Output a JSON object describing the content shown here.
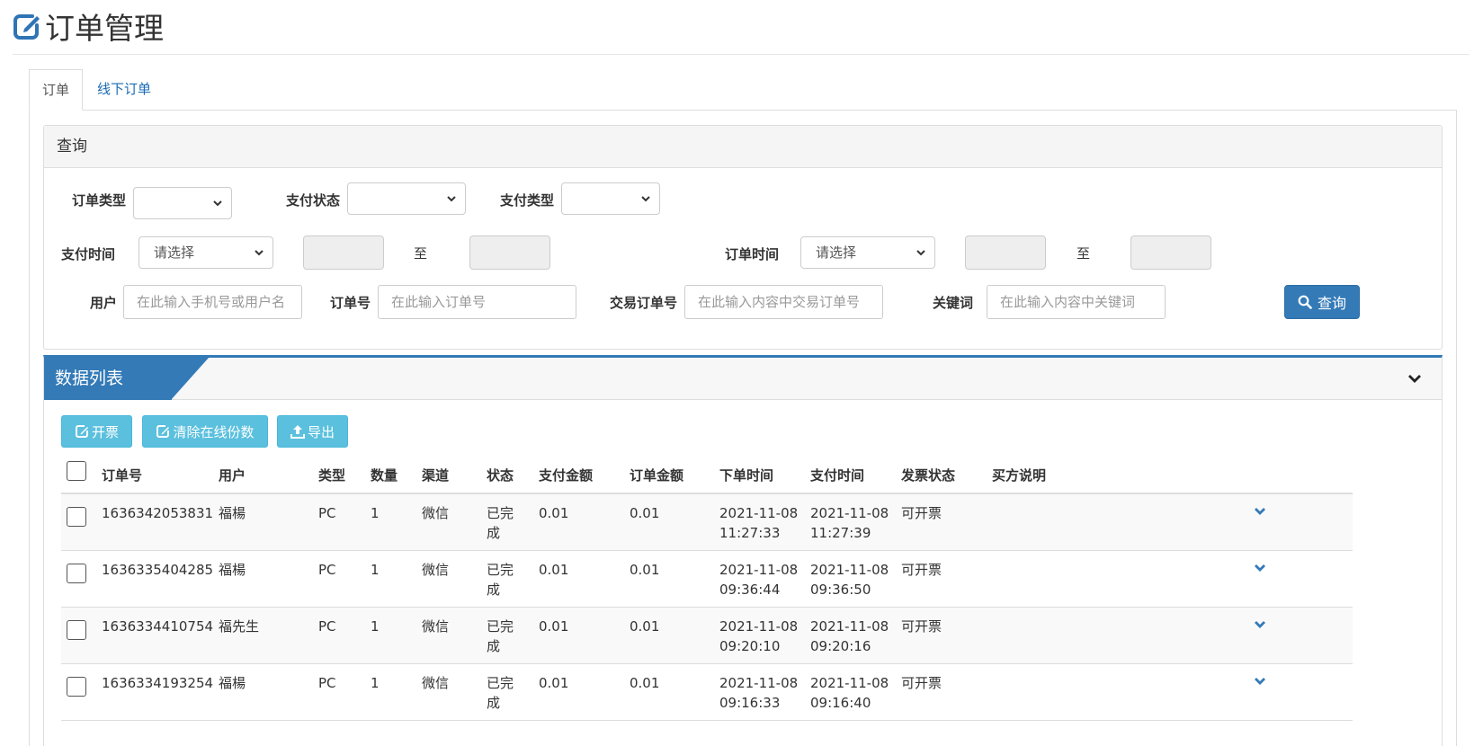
{
  "page": {
    "title": "订单管理"
  },
  "tabs": [
    {
      "label": "订单",
      "active": true
    },
    {
      "label": "线下订单",
      "active": false
    }
  ],
  "query": {
    "panel_title": "查询",
    "order_type": {
      "label": "订单类型",
      "value": ""
    },
    "pay_status": {
      "label": "支付状态",
      "value": ""
    },
    "pay_type": {
      "label": "支付类型",
      "value": ""
    },
    "pay_time": {
      "label": "支付时间",
      "value": "请选择",
      "to": "至"
    },
    "order_time": {
      "label": "订单时间",
      "value": "请选择",
      "to": "至"
    },
    "user": {
      "label": "用户",
      "placeholder": "在此输入手机号或用户名"
    },
    "order_no": {
      "label": "订单号",
      "placeholder": "在此输入订单号"
    },
    "trade_no": {
      "label": "交易订单号",
      "placeholder": "在此输入内容中交易订单号"
    },
    "keyword": {
      "label": "关键词",
      "placeholder": "在此输入内容中关键词"
    },
    "search_button": "查询"
  },
  "list": {
    "panel_title": "数据列表",
    "toolbar": {
      "invoice": "开票",
      "clear_online": "清除在线份数",
      "export": "导出"
    },
    "columns": [
      "订单号",
      "用户",
      "类型",
      "数量",
      "渠道",
      "状态",
      "支付金额",
      "订单金额",
      "下单时间",
      "支付时间",
      "发票状态",
      "买方说明"
    ],
    "rows": [
      {
        "order_no": "1636342053831",
        "user": "福楊",
        "type": "PC",
        "qty": "1",
        "channel": "微信",
        "status": "已完成",
        "paid": "0.01",
        "amount": "0.01",
        "order_date": "2021-11-08",
        "order_clock": "11:27:33",
        "pay_date": "2021-11-08",
        "pay_clock": "11:27:39",
        "invoice": "可开票",
        "remark": ""
      },
      {
        "order_no": "1636335404285",
        "user": "福楊",
        "type": "PC",
        "qty": "1",
        "channel": "微信",
        "status": "已完成",
        "paid": "0.01",
        "amount": "0.01",
        "order_date": "2021-11-08",
        "order_clock": "09:36:44",
        "pay_date": "2021-11-08",
        "pay_clock": "09:36:50",
        "invoice": "可开票",
        "remark": ""
      },
      {
        "order_no": "1636334410754",
        "user": "福先生",
        "type": "PC",
        "qty": "1",
        "channel": "微信",
        "status": "已完成",
        "paid": "0.01",
        "amount": "0.01",
        "order_date": "2021-11-08",
        "order_clock": "09:20:10",
        "pay_date": "2021-11-08",
        "pay_clock": "09:20:16",
        "invoice": "可开票",
        "remark": ""
      },
      {
        "order_no": "1636334193254",
        "user": "福楊",
        "type": "PC",
        "qty": "1",
        "channel": "微信",
        "status": "已完成",
        "paid": "0.01",
        "amount": "0.01",
        "order_date": "2021-11-08",
        "order_clock": "09:16:33",
        "pay_date": "2021-11-08",
        "pay_clock": "09:16:40",
        "invoice": "可开票",
        "remark": ""
      }
    ]
  },
  "colors": {
    "primary": "#337ab7",
    "info": "#5bc0de",
    "link": "#1a6bb5"
  }
}
